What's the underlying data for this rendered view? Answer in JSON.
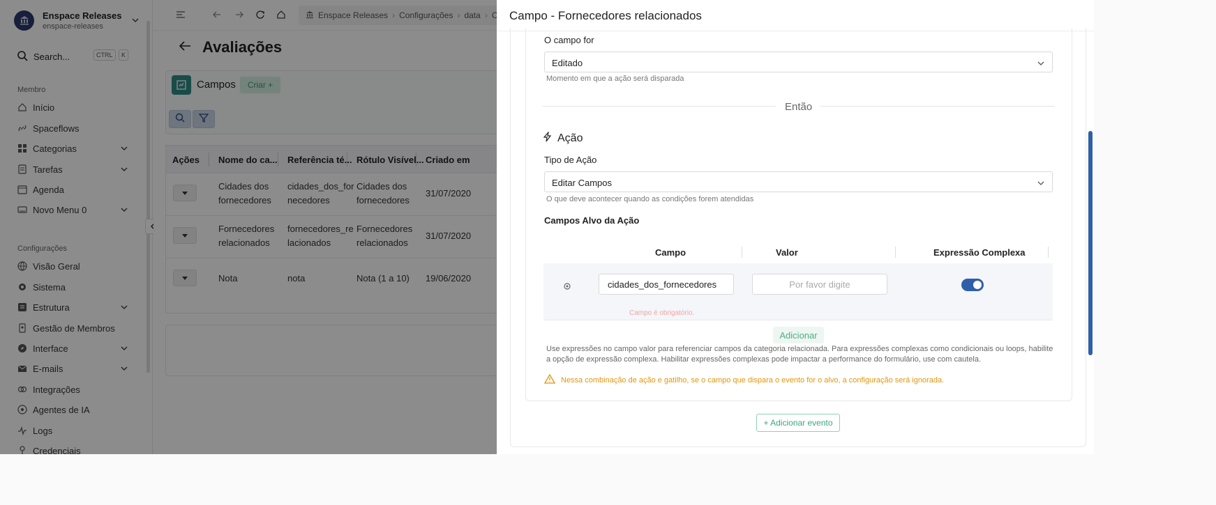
{
  "org": {
    "name": "Enspace Releases",
    "slug": "enspace-releases"
  },
  "search": {
    "label": "Search...",
    "kbd1": "CTRL",
    "kbd2": "K"
  },
  "sidebar": {
    "section_member": "Membro",
    "member_items": [
      {
        "label": "Início",
        "icon": "home-icon"
      },
      {
        "label": "Spaceflows",
        "icon": "link-icon"
      },
      {
        "label": "Categorias",
        "icon": "grid-icon"
      },
      {
        "label": "Tarefas",
        "icon": "tasks-icon"
      },
      {
        "label": "Agenda",
        "icon": "calendar-icon"
      },
      {
        "label": "Novo Menu 0",
        "icon": "keyboard-icon"
      }
    ],
    "section_config": "Configurações",
    "config_items": [
      {
        "label": "Visão Geral",
        "icon": "globe-icon"
      },
      {
        "label": "Sistema",
        "icon": "gear-icon"
      },
      {
        "label": "Estrutura",
        "icon": "structure-icon"
      },
      {
        "label": "Gestão de Membros",
        "icon": "badge-icon"
      },
      {
        "label": "Interface",
        "icon": "compass-icon"
      },
      {
        "label": "E-mails",
        "icon": "mail-icon"
      },
      {
        "label": "Integrações",
        "icon": "integration-icon"
      },
      {
        "label": "Agentes de IA",
        "icon": "ai-icon"
      },
      {
        "label": "Logs",
        "icon": "pulse-icon"
      },
      {
        "label": "Credenciais",
        "icon": "key-icon"
      }
    ]
  },
  "breadcrumb": {
    "items": [
      "Enspace Releases",
      "Configurações",
      "data",
      "C"
    ]
  },
  "page": {
    "title": "Avaliações"
  },
  "fields_card": {
    "title": "Campos",
    "create_label": "Criar +"
  },
  "table": {
    "headers": [
      "Ações",
      "Nome do ca...",
      "Referência té...",
      "Rótulo Visível...",
      "Criado em"
    ],
    "rows": [
      {
        "name1": "Cidades dos",
        "name2": "fornecedores",
        "ref1": "cidades_dos_for",
        "ref2": "necedores",
        "label1": "Cidades dos",
        "label2": "fornecedores",
        "created": "31/07/2020"
      },
      {
        "name1": "Fornecedores",
        "name2": "relacionados",
        "ref1": "fornecedores_re",
        "ref2": "lacionados",
        "label1": "Fornecedores",
        "label2": "relacionados",
        "created": "31/07/2020"
      },
      {
        "name1": "Nota",
        "name2": "",
        "ref1": "nota",
        "ref2": "",
        "label1": "Nota (1 a 10)",
        "label2": "",
        "created": "19/06/2020"
      }
    ]
  },
  "drawer": {
    "title": "Campo - Fornecedores relacionados",
    "trigger_label": "O campo for",
    "trigger_value": "Editado",
    "trigger_help": "Momento em que a ação será disparada",
    "then_label": "Então",
    "action_title": "Ação",
    "action_type_label": "Tipo de Ação",
    "action_type_value": "Editar Campos",
    "action_type_help": "O que deve acontecer quando as condições forem atendidas",
    "targets_label": "Campos Alvo da Ação",
    "targets_headers": {
      "field": "Campo",
      "value": "Valor",
      "complex": "Expressão Complexa"
    },
    "target_row": {
      "field_value": "cidades_dos_fornecedores",
      "value_placeholder": "Por favor digite",
      "error": "Campo é obrigatório.",
      "complex_enabled": true
    },
    "add_label": "Adicionar",
    "note": "Use expressões no campo valor para referenciar campos da categoria relacionada. Para expressões complexas como condicionais ou loops, habilite a opção de expressão complexa. Habilitar expressões complexas pode impactar a performance do formulário, use com cautela.",
    "warning": "Nessa combinação de ação e gatilho, se o campo que dispara o evento for o alvo, a configuração será ignorada.",
    "add_event_label": "+ Adicionar evento"
  },
  "colors": {
    "accent": "#2f5fa8",
    "success": "#3aa77c",
    "warning": "#e2950d",
    "error": "#f4a3a3"
  }
}
